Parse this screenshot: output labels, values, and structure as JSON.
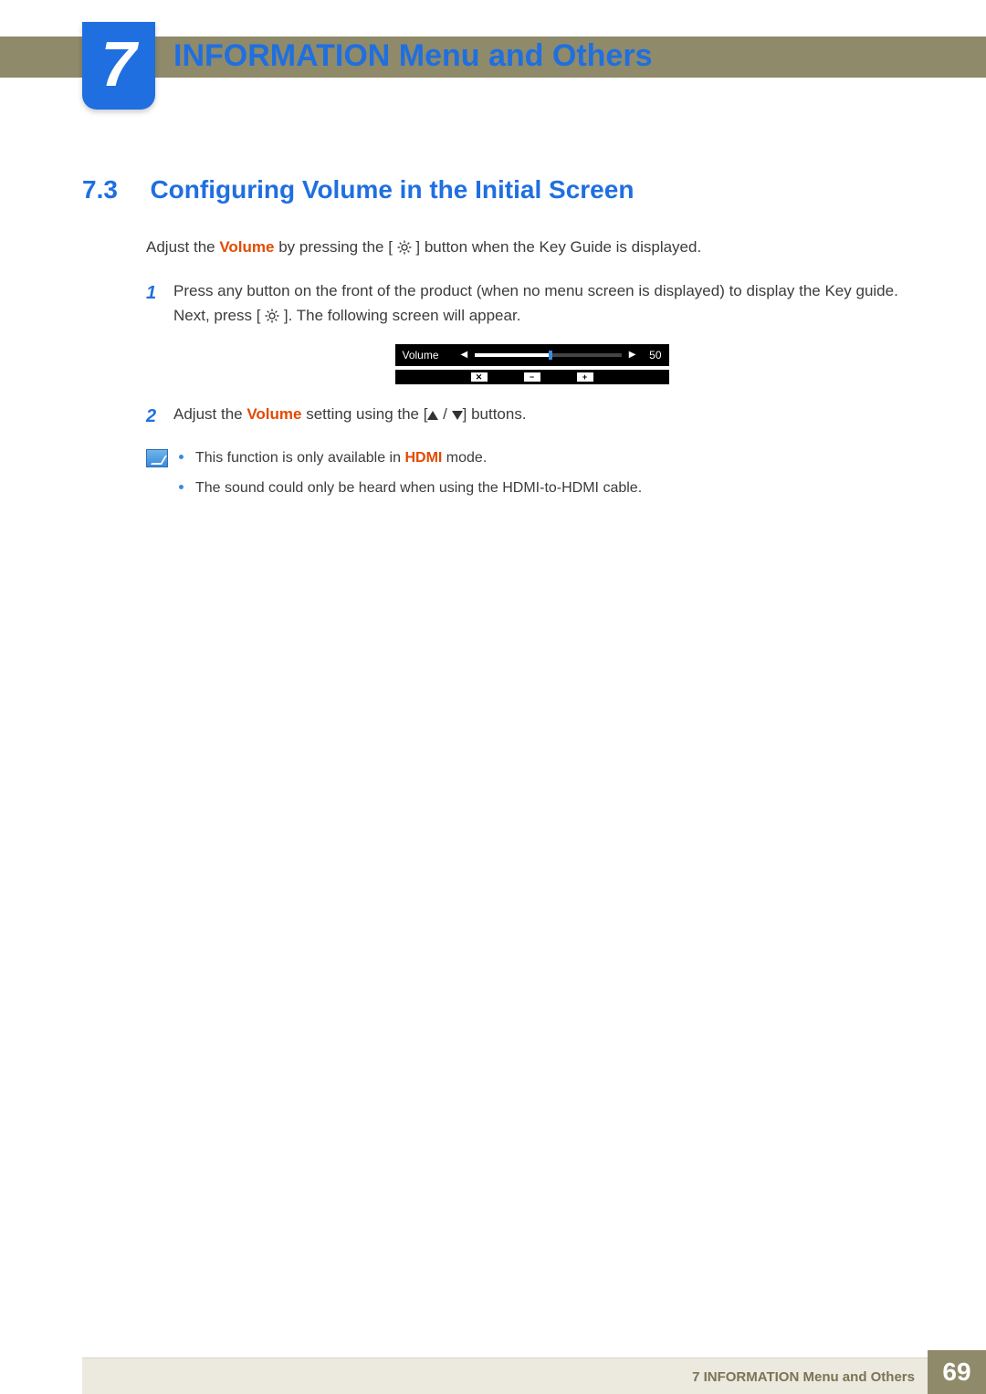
{
  "chapter": {
    "number": "7",
    "title": "INFORMATION Menu and Others"
  },
  "section": {
    "number": "7.3",
    "title": "Configuring Volume in the Initial Screen"
  },
  "intro": {
    "pre": "Adjust the ",
    "volume_word": "Volume",
    "mid": " by pressing the [ ",
    "post": " ] button when the Key Guide is displayed."
  },
  "steps": {
    "s1": {
      "num": "1",
      "pre": "Press any button on the front of the product (when no menu screen is displayed) to display the Key guide. Next, press [ ",
      "post": " ]. The following screen will appear."
    },
    "s2": {
      "num": "2",
      "pre": "Adjust the ",
      "volume_word": "Volume",
      "mid": " setting using the [",
      "sep": " / ",
      "post": "] buttons."
    }
  },
  "osd": {
    "label": "Volume",
    "value": "50",
    "btn_close": "✕",
    "btn_minus": "−",
    "btn_plus": "+"
  },
  "notes": {
    "n1_pre": "This function is only available in ",
    "n1_hdmi": "HDMI",
    "n1_post": " mode.",
    "n2": "The sound could only be heard when using the HDMI-to-HDMI cable."
  },
  "footer": {
    "text": "7 INFORMATION Menu and Others",
    "page": "69"
  }
}
